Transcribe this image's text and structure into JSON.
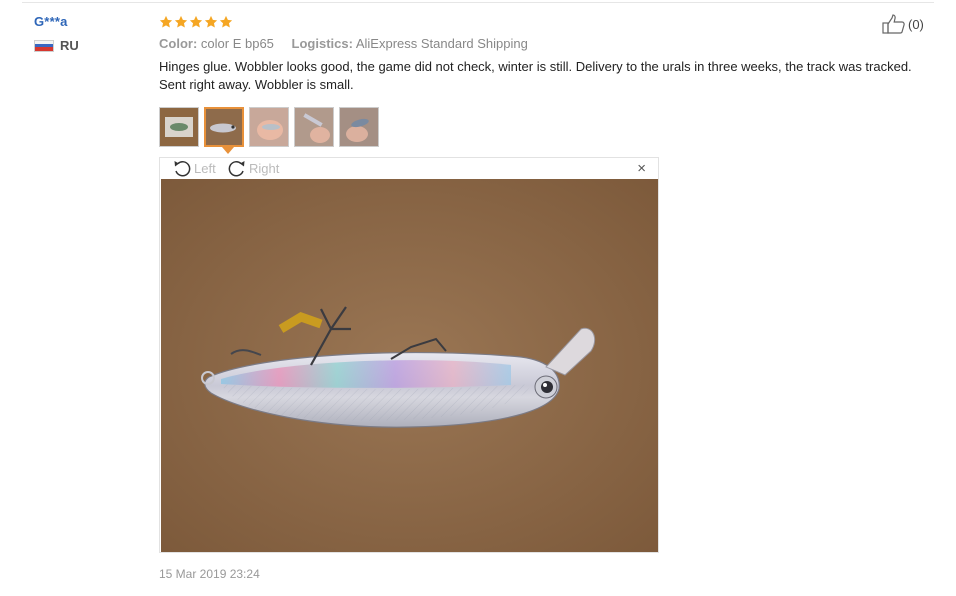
{
  "reviewer": {
    "name": "G***a",
    "country_code": "RU"
  },
  "review": {
    "rating_stars": 5,
    "color_label": "Color:",
    "color_value": "color E bp65",
    "logistics_label": "Logistics:",
    "logistics_value": "AliExpress Standard Shipping",
    "text": "Hinges glue. Wobbler looks good, the game did not check, winter is still. Delivery to the urals in three weeks, the track was tracked. Sent right away. Wobbler is small.",
    "timestamp": "15 Mar 2019 23:24"
  },
  "helpful": {
    "count_text": "(0)"
  },
  "viewer": {
    "rotate_left_label": "Left",
    "rotate_right_label": "Right",
    "close_symbol": "×"
  },
  "thumbnails": {
    "count": 5,
    "active_index": 1
  },
  "colors": {
    "username": "#2e66b8",
    "star": "#f5a623",
    "active_thumb_border": "#e8913a"
  },
  "icons": [
    "thumbs-up-icon",
    "rotate-left-icon",
    "rotate-right-icon",
    "close-icon",
    "star-icon",
    "flag-icon"
  ]
}
